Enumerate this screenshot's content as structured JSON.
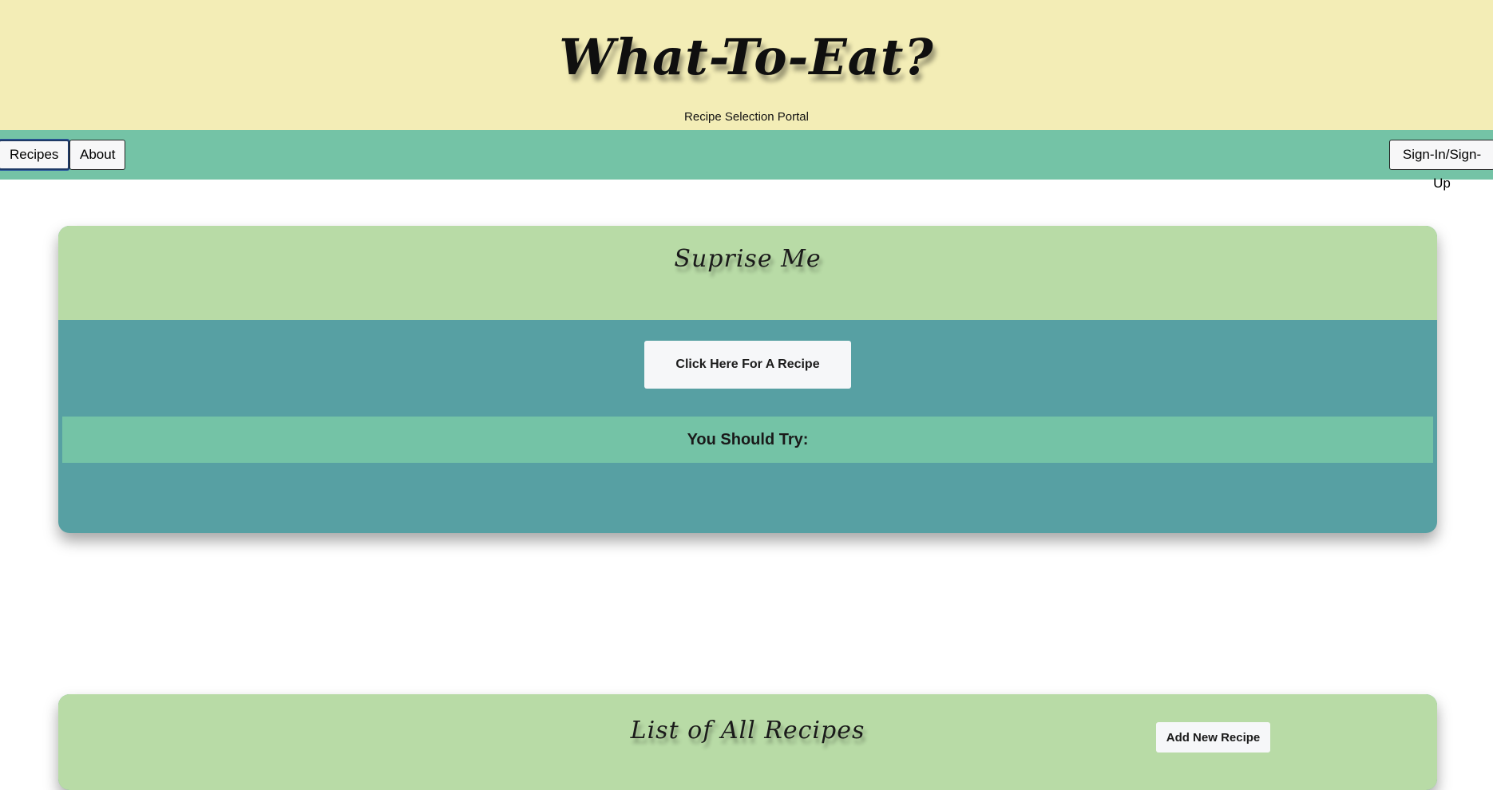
{
  "header": {
    "title": "What-To-Eat?",
    "subtitle": "Recipe Selection Portal",
    "background": "#f3edb6"
  },
  "nav": {
    "background": "#74c3a6",
    "items": [
      {
        "label": "Recipes",
        "active": true
      },
      {
        "label": "About",
        "active": false
      }
    ],
    "auth_label": "Sign-In/Sign-Up"
  },
  "surprise": {
    "title": "Suprise Me",
    "button_label": "Click Here For A Recipe",
    "result_label": "You Should Try:",
    "result_value": ""
  },
  "recipes_list": {
    "title": "List of All Recipes",
    "add_button_label": "Add New Recipe"
  },
  "colors": {
    "card_header": "#b8dba6",
    "card_body": "#57a0a3",
    "accent": "#74c3a6"
  }
}
